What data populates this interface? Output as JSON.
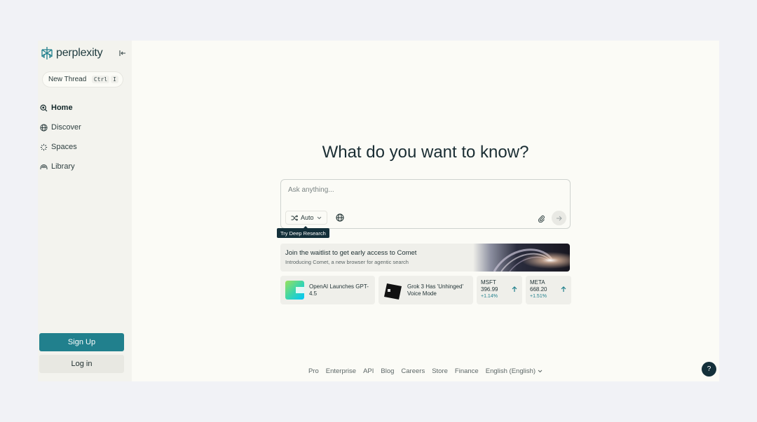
{
  "brand": {
    "name": "perplexity"
  },
  "sidebar": {
    "new_thread": {
      "label": "New Thread",
      "kbd1": "Ctrl",
      "kbd2": "I"
    },
    "nav": [
      {
        "label": "Home",
        "icon": "search-icon",
        "active": true
      },
      {
        "label": "Discover",
        "icon": "globe-icon"
      },
      {
        "label": "Spaces",
        "icon": "spaces-icon"
      },
      {
        "label": "Library",
        "icon": "library-icon"
      }
    ],
    "signup_label": "Sign Up",
    "login_label": "Log in"
  },
  "main": {
    "headline": "What do you want to know?",
    "search": {
      "placeholder": "Ask anything...",
      "mode_label": "Auto",
      "tooltip": "Try Deep Research"
    },
    "promo": {
      "title": "Join the waitlist to get early access to Comet",
      "subtitle": "Introducing Comet, a new browser for agentic search"
    },
    "news": [
      {
        "title": "OpenAI Launches GPT-4.5"
      },
      {
        "title": "Grok 3 Has 'Unhinged' Voice Mode"
      }
    ],
    "stocks": [
      {
        "symbol": "MSFT",
        "price": "396.99",
        "change": "+1.14%"
      },
      {
        "symbol": "META",
        "price": "668.20",
        "change": "+1.51%"
      }
    ]
  },
  "footer": {
    "links": [
      "Pro",
      "Enterprise",
      "API",
      "Blog",
      "Careers",
      "Store",
      "Finance"
    ],
    "language": "English (English)"
  },
  "help_label": "?",
  "colors": {
    "accent": "#21808d",
    "dark": "#14303a",
    "background": "#fbfbf6",
    "sidebar": "#f3f3ee"
  }
}
